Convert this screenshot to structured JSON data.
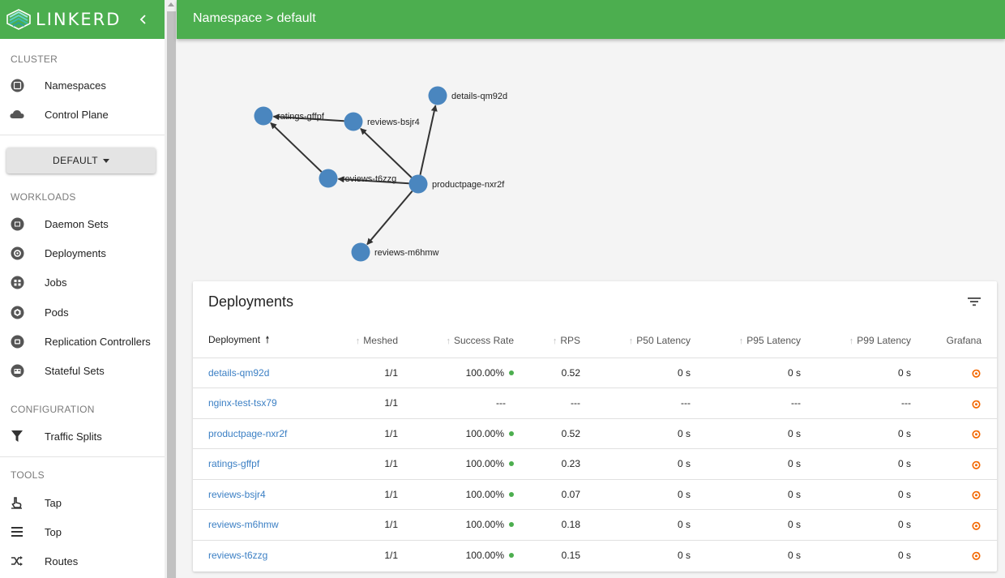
{
  "brand": {
    "name": "LINKERD"
  },
  "header": {
    "title": "Namespace > default"
  },
  "colors": {
    "brand_green": "#4cae4f",
    "link_blue": "#3b7fc4",
    "node_blue": "#4a86bf",
    "status_green": "#4cae4f",
    "grafana_orange": "#f46800"
  },
  "sidebar": {
    "cluster_heading": "CLUSTER",
    "cluster_items": [
      {
        "label": "Namespaces",
        "icon": "namespaces-icon"
      },
      {
        "label": "Control Plane",
        "icon": "cloud-icon"
      }
    ],
    "namespace_button": "DEFAULT",
    "workloads_heading": "WORKLOADS",
    "workload_items": [
      {
        "label": "Daemon Sets",
        "icon": "daemonset-icon"
      },
      {
        "label": "Deployments",
        "icon": "deployment-icon"
      },
      {
        "label": "Jobs",
        "icon": "job-icon"
      },
      {
        "label": "Pods",
        "icon": "pod-icon"
      },
      {
        "label": "Replication Controllers",
        "icon": "replication-controller-icon"
      },
      {
        "label": "Stateful Sets",
        "icon": "statefulset-icon"
      }
    ],
    "configuration_heading": "CONFIGURATION",
    "configuration_items": [
      {
        "label": "Traffic Splits",
        "icon": "filter-funnel-icon"
      }
    ],
    "tools_heading": "TOOLS",
    "tools_items": [
      {
        "label": "Tap",
        "icon": "tap-icon"
      },
      {
        "label": "Top",
        "icon": "list-icon"
      },
      {
        "label": "Routes",
        "icon": "shuffle-icon"
      }
    ]
  },
  "graph": {
    "nodes": [
      "details-qm92d",
      "ratings-gffpf",
      "reviews-bsjr4",
      "reviews-t6zzg",
      "productpage-nxr2f",
      "reviews-m6hmw"
    ],
    "edges": [
      [
        "productpage-nxr2f",
        "details-qm92d"
      ],
      [
        "productpage-nxr2f",
        "reviews-bsjr4"
      ],
      [
        "productpage-nxr2f",
        "reviews-t6zzg"
      ],
      [
        "productpage-nxr2f",
        "reviews-m6hmw"
      ],
      [
        "reviews-bsjr4",
        "ratings-gffpf"
      ],
      [
        "reviews-t6zzg",
        "ratings-gffpf"
      ]
    ]
  },
  "deployments": {
    "title": "Deployments",
    "columns": {
      "deployment": "Deployment",
      "meshed": "Meshed",
      "success_rate": "Success Rate",
      "rps": "RPS",
      "p50": "P50 Latency",
      "p95": "P95 Latency",
      "p99": "P99 Latency",
      "grafana": "Grafana"
    },
    "rows": [
      {
        "name": "details-qm92d",
        "meshed": "1/1",
        "success_rate": "100.00%",
        "healthy": true,
        "rps": "0.52",
        "p50": "0 s",
        "p95": "0 s",
        "p99": "0 s"
      },
      {
        "name": "nginx-test-tsx79",
        "meshed": "1/1",
        "success_rate": "---",
        "healthy": false,
        "rps": "---",
        "p50": "---",
        "p95": "---",
        "p99": "---"
      },
      {
        "name": "productpage-nxr2f",
        "meshed": "1/1",
        "success_rate": "100.00%",
        "healthy": true,
        "rps": "0.52",
        "p50": "0 s",
        "p95": "0 s",
        "p99": "0 s"
      },
      {
        "name": "ratings-gffpf",
        "meshed": "1/1",
        "success_rate": "100.00%",
        "healthy": true,
        "rps": "0.23",
        "p50": "0 s",
        "p95": "0 s",
        "p99": "0 s"
      },
      {
        "name": "reviews-bsjr4",
        "meshed": "1/1",
        "success_rate": "100.00%",
        "healthy": true,
        "rps": "0.07",
        "p50": "0 s",
        "p95": "0 s",
        "p99": "0 s"
      },
      {
        "name": "reviews-m6hmw",
        "meshed": "1/1",
        "success_rate": "100.00%",
        "healthy": true,
        "rps": "0.18",
        "p50": "0 s",
        "p95": "0 s",
        "p99": "0 s"
      },
      {
        "name": "reviews-t6zzg",
        "meshed": "1/1",
        "success_rate": "100.00%",
        "healthy": true,
        "rps": "0.15",
        "p50": "0 s",
        "p95": "0 s",
        "p99": "0 s"
      }
    ]
  }
}
